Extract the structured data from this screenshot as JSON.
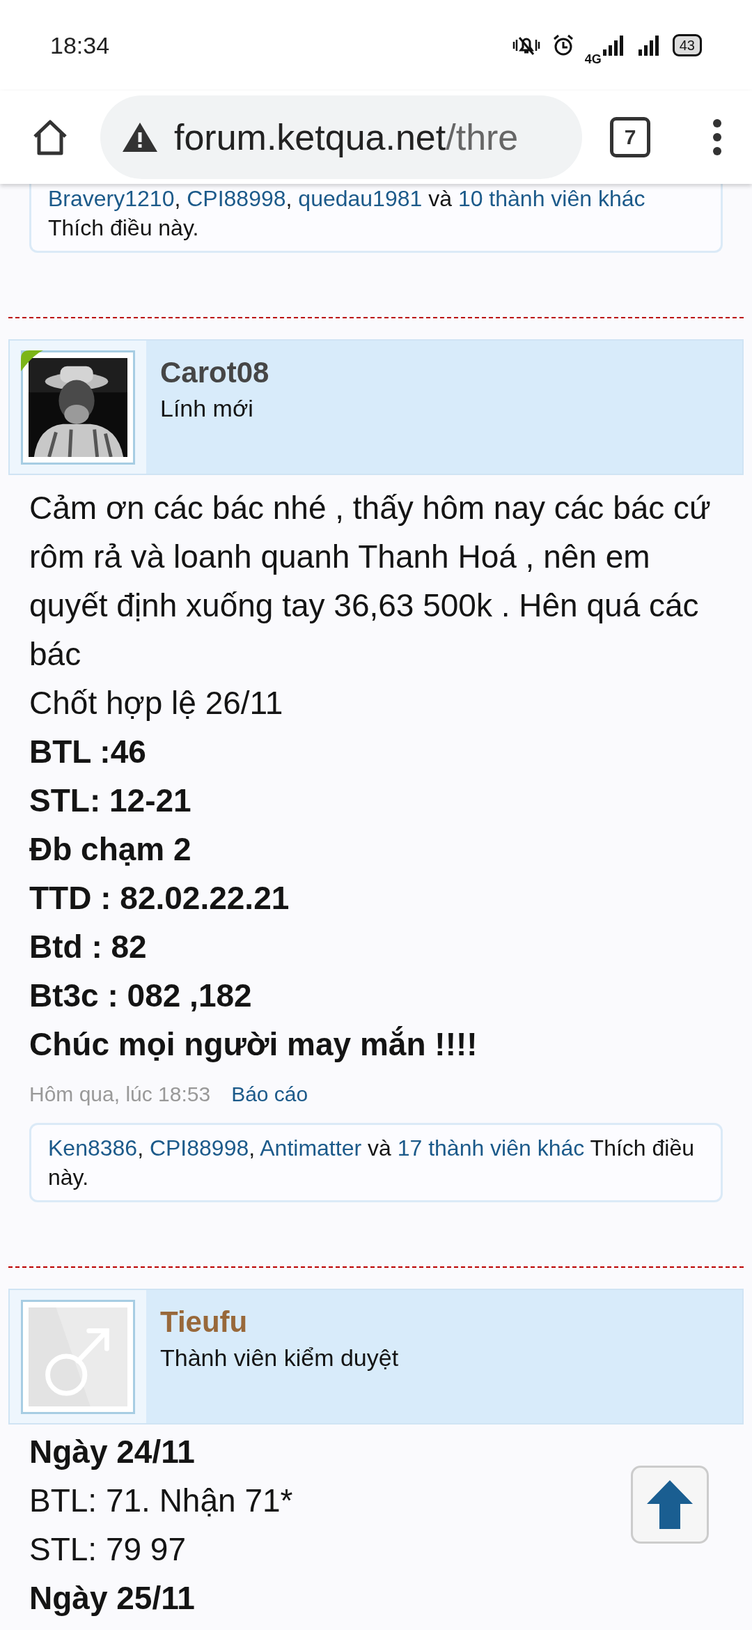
{
  "status_bar": {
    "time": "18:34",
    "network": "4G",
    "battery": "43"
  },
  "browser": {
    "url_host": "forum.ketqua.net",
    "url_path": "/thre",
    "tab_count": "7"
  },
  "previous_likes": [
    {
      "text": "Bravery1210",
      "kind": "link"
    },
    {
      "text": ", ",
      "kind": "plain"
    },
    {
      "text": "CPI88998",
      "kind": "link"
    },
    {
      "text": ", ",
      "kind": "plain"
    },
    {
      "text": "quedau1981",
      "kind": "link"
    },
    {
      "text": " và ",
      "kind": "plain"
    },
    {
      "text": "10 thành viên khác",
      "kind": "link"
    },
    {
      "text": " Thích điều này.",
      "kind": "plain"
    }
  ],
  "posts": [
    {
      "author": "Carot08",
      "color": "#464646",
      "title": "Lính mới",
      "avatar": {
        "kind": "picture"
      },
      "online": true,
      "lines": [
        {
          "text": "Cảm ơn các bác nhé , thấy hôm nay các bác cứ rôm rả và loanh quanh Thanh Hoá , nên em quyết định xuống tay 36,63 500k . Hên quá các bác",
          "bold": false
        },
        {
          "text": "Chốt hợp lệ 26/11",
          "bold": false
        },
        {
          "text": "BTL :46",
          "bold": true
        },
        {
          "text": "STL: 12-21",
          "bold": true
        },
        {
          "text": "Đb chạm 2",
          "bold": true
        },
        {
          "text": "TTD : 82.02.22.21",
          "bold": true
        },
        {
          "text": "Btd : 82",
          "bold": true
        },
        {
          "text": "Bt3c : 082 ,182",
          "bold": true
        },
        {
          "text": "Chúc mọi người may mắn !!!!",
          "bold": true
        }
      ],
      "date": "Hôm qua, lúc 18:53",
      "report": "Báo cáo",
      "likes": [
        {
          "text": "Ken8386",
          "kind": "link"
        },
        {
          "text": ", ",
          "kind": "plain"
        },
        {
          "text": "CPI88998",
          "kind": "link"
        },
        {
          "text": ", ",
          "kind": "plain"
        },
        {
          "text": "Antimatter",
          "kind": "link"
        },
        {
          "text": " và ",
          "kind": "plain"
        },
        {
          "text": "17 thành viên khác",
          "kind": "link"
        },
        {
          "text": " Thích điều này.",
          "kind": "plain"
        }
      ]
    },
    {
      "author": "Tieufu",
      "color": "#98683a",
      "title": "Thành viên kiểm duyệt",
      "avatar": {
        "kind": "default"
      },
      "online": false,
      "lines": [
        {
          "text": "Ngày 24/11",
          "bold": true
        },
        {
          "text": "BTL: 71. Nhận 71*",
          "bold": false
        },
        {
          "text": "STL: 79 97",
          "bold": false
        },
        {
          "text": "Ngày 25/11",
          "bold": true
        }
      ]
    }
  ]
}
